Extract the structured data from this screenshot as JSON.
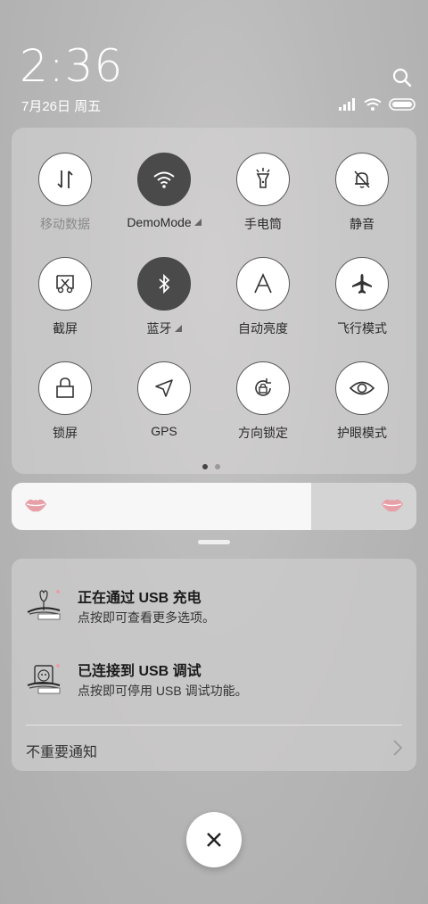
{
  "status_bar": {
    "time": "2:36",
    "date": "7月26日 周五"
  },
  "quick_settings": {
    "tiles": [
      {
        "label": "移动数据",
        "icon": "mobile-data-icon",
        "active": false,
        "dim": true
      },
      {
        "label": "DemoMode",
        "icon": "wifi-icon",
        "active": true,
        "expandable": true
      },
      {
        "label": "手电筒",
        "icon": "flashlight-icon",
        "active": false
      },
      {
        "label": "静音",
        "icon": "bell-mute-icon",
        "active": false
      },
      {
        "label": "截屏",
        "icon": "screenshot-icon",
        "active": false
      },
      {
        "label": "蓝牙",
        "icon": "bluetooth-icon",
        "active": true,
        "expandable": true
      },
      {
        "label": "自动亮度",
        "icon": "auto-brightness-icon",
        "active": false
      },
      {
        "label": "飞行模式",
        "icon": "airplane-icon",
        "active": false
      },
      {
        "label": "锁屏",
        "icon": "lock-icon",
        "active": false
      },
      {
        "label": "GPS",
        "icon": "gps-icon",
        "active": false
      },
      {
        "label": "方向锁定",
        "icon": "rotation-lock-icon",
        "active": false
      },
      {
        "label": "护眼模式",
        "icon": "eye-icon",
        "active": false
      }
    ],
    "page_indicator": {
      "current": 1,
      "total": 2
    }
  },
  "brightness": {
    "level": 0.74
  },
  "notifications": [
    {
      "title": "正在通过 USB 充电",
      "description": "点按即可查看更多选项。"
    },
    {
      "title": "已连接到 USB 调试",
      "description": "点按即可停用 USB 调试功能。"
    }
  ],
  "unimportant_label": "不重要通知",
  "colors": {
    "active_tile": "#4a4a4a",
    "accent_pink": "#e8a0a8"
  }
}
